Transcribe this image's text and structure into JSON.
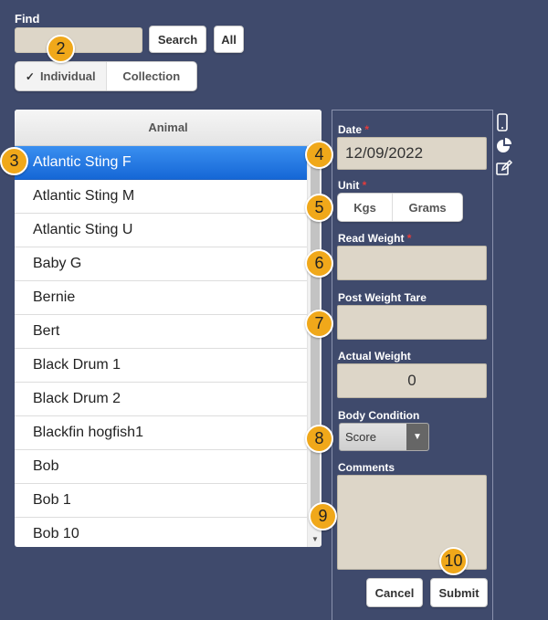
{
  "find": {
    "label": "Find",
    "input_value": "",
    "search_label": "Search",
    "all_label": "All"
  },
  "mode": {
    "individual_check": "✓",
    "individual_label": "Individual",
    "collection_label": "Collection",
    "selected": "Individual"
  },
  "animal_list": {
    "header": "Animal",
    "items": [
      "Atlantic Sting F",
      "Atlantic Sting M",
      "Atlantic Sting U",
      "Baby G",
      "Bernie",
      "Bert",
      "Black Drum 1",
      "Black Drum 2",
      "Blackfin hogfish1",
      "Bob",
      "Bob 1",
      "Bob 10"
    ],
    "selected_index": 0
  },
  "form": {
    "date_label": "Date",
    "date_value": "12/09/2022",
    "unit_label": "Unit",
    "unit_options": [
      "Kgs",
      "Grams"
    ],
    "read_weight_label": "Read Weight",
    "read_weight_value": "",
    "post_weight_tare_label": "Post Weight Tare",
    "post_weight_tare_value": "",
    "actual_weight_label": "Actual Weight",
    "actual_weight_value": "0",
    "body_condition_label": "Body Condition",
    "body_condition_value": "Score",
    "comments_label": "Comments",
    "comments_value": "",
    "required_mark": "*",
    "cancel_label": "Cancel",
    "submit_label": "Submit"
  },
  "side_icons": [
    "mobile-icon",
    "pie-chart-icon",
    "edit-icon"
  ],
  "callouts": [
    "2",
    "3",
    "4",
    "5",
    "6",
    "7",
    "8",
    "9",
    "10"
  ],
  "colors": {
    "background": "#3f4a6c",
    "field": "#ddd6c8",
    "selected_row": "#1567d6",
    "callout": "#f0a81a",
    "required": "#e53b3b"
  }
}
